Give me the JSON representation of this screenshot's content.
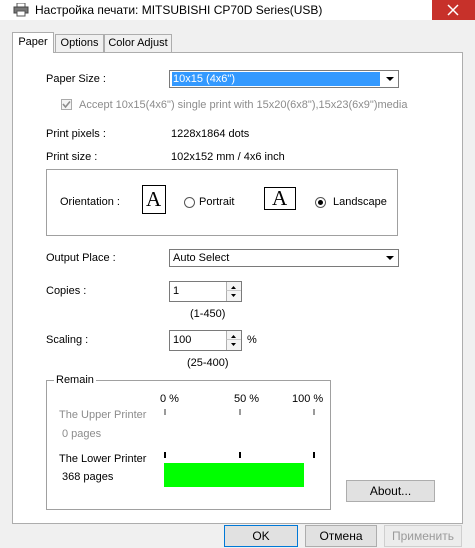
{
  "window": {
    "title": "Настройка печати: MITSUBISHI CP70D Series(USB)",
    "close_icon": "close-icon",
    "printer_icon": "printer-icon"
  },
  "tabs": [
    {
      "label": "Paper",
      "active": true
    },
    {
      "label": "Options",
      "active": false
    },
    {
      "label": "Color Adjust",
      "active": false
    }
  ],
  "paper": {
    "paper_size_label": "Paper Size :",
    "paper_size_value": "10x15 (4x6\")",
    "accept_label": "Accept 10x15(4x6\") single print with 15x20(6x8\"),15x23(6x9\")media",
    "accept_checked": true,
    "print_pixels_label": "Print pixels :",
    "print_pixels_value": "1228x1864 dots",
    "print_size_label": "Print size :",
    "print_size_value": "102x152 mm / 4x6 inch",
    "orientation_label": "Orientation :",
    "portrait_label": "Portrait",
    "landscape_label": "Landscape",
    "orientation_selected": "Landscape",
    "orientation_glyph": "A",
    "output_place_label": "Output Place :",
    "output_place_value": "Auto Select",
    "copies_label": "Copies :",
    "copies_value": "1",
    "copies_range": "(1-450)",
    "scaling_label": "Scaling :",
    "scaling_value": "100",
    "scaling_unit": "%",
    "scaling_range": "(25-400)"
  },
  "remain": {
    "title": "Remain",
    "scale_0": "0 %",
    "scale_50": "50 %",
    "scale_100": "100 %",
    "upper_printer_label": "The Upper Printer",
    "upper_pages": "0 pages",
    "lower_printer_label": "The Lower Printer",
    "lower_pages": "368 pages",
    "lower_level": 0.93,
    "level_color": "#00ff00"
  },
  "about_button": "About...",
  "footer": {
    "ok": "OK",
    "cancel": "Отмена",
    "apply": "Применить"
  }
}
